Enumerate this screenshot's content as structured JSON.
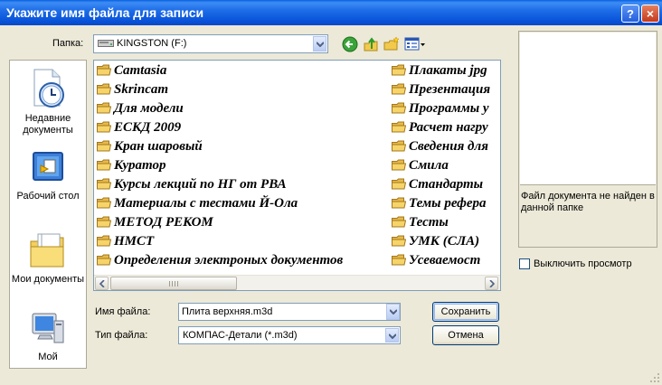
{
  "window": {
    "title": "Укажите имя файла для записи",
    "help_glyph": "?",
    "close_glyph": "×"
  },
  "lookin": {
    "label": "Папка:",
    "value": "KINGSTON (F:)"
  },
  "toolbar": {
    "icons": [
      "back-icon",
      "up-folder-icon",
      "new-folder-icon",
      "view-menu-icon"
    ]
  },
  "places": [
    {
      "label": "Недавние документы",
      "icon": "recent-documents-icon"
    },
    {
      "label": "Рабочий стол",
      "icon": "desktop-icon"
    },
    {
      "label": "Мои документы",
      "icon": "my-documents-icon"
    },
    {
      "label": "Мой",
      "icon": "my-computer-icon"
    }
  ],
  "files": {
    "col1": [
      "Camtasia",
      "Skrincam",
      "Для модели",
      "ЕСКД 2009",
      "Кран шаровый",
      "Куратор",
      "Курсы лекций по НГ от РВА",
      "Материалы с тестами Й-Ола",
      "МЕТОД РЕКОМ",
      "НМСТ",
      "Определения электроных документов"
    ],
    "col2": [
      "Плакаты jpg",
      "Презентация",
      "Программы у",
      "Расчет нагру",
      "Сведения для",
      "Смила",
      "Стандарты",
      "Темы рефера",
      "Тесты",
      "УМК (СЛА)",
      "Усеваемост"
    ]
  },
  "filename": {
    "label": "Имя файла:",
    "value": "Плита верхняя.m3d"
  },
  "filetype": {
    "label": "Тип файла:",
    "value": "КОМПАС-Детали (*.m3d)"
  },
  "buttons": {
    "save": "Сохранить",
    "cancel": "Отмена"
  },
  "preview": {
    "message": "Файл документа не найден в данной папке",
    "toggle_label": "Выключить просмотр",
    "toggle_checked": false
  },
  "colors": {
    "titlebar": "#0a5fe0",
    "folder": "#f2c94c",
    "window_bg": "#ece9d8"
  }
}
